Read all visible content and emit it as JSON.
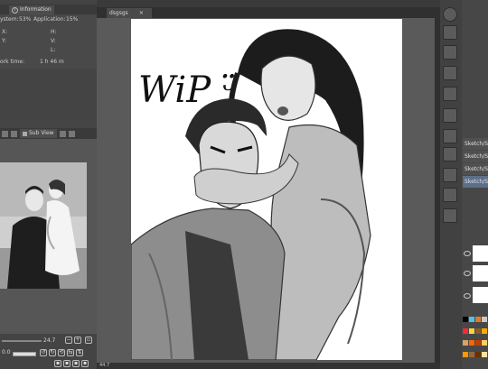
{
  "info_panel": {
    "tab_label": "Information",
    "memory_label": "ystem:",
    "memory_value": "53%",
    "app_label": "Application:",
    "app_value": "15%",
    "x_label": "X:",
    "y_label": "Y:",
    "h_label": "H:",
    "v_label": "V:",
    "l_label": "L:",
    "work_time_label": "ork time:",
    "work_time_value": "1 h 46 m"
  },
  "sub_view": {
    "tab_label": "Sub View"
  },
  "navigator": {
    "zoom_value": "24.7",
    "rotation_value": "0.0"
  },
  "document": {
    "tab_label": "dsgsgs",
    "canvas_text": "WiP ᵕ̈",
    "status_zoom": "44.7"
  },
  "layers": [
    {
      "name": "Sketch/S"
    },
    {
      "name": "Sketch/S"
    },
    {
      "name": "Sketch/S"
    },
    {
      "name": "Sketch/S"
    }
  ],
  "colors": {
    "panel": "#444444",
    "canvas": "#ffffff",
    "selected_layer": "#5c6f8a"
  },
  "palette": [
    "#000000",
    "#4dc3e6",
    "#e07a2f",
    "#c8c8c8",
    "#ff2a2a",
    "#ffd23f",
    "#8a5a2b",
    "#ffaa00",
    "#e0a060",
    "#ff6600",
    "#c04000",
    "#ffcc66",
    "#ff9900",
    "#996633",
    "#663300",
    "#ffe0a0"
  ]
}
